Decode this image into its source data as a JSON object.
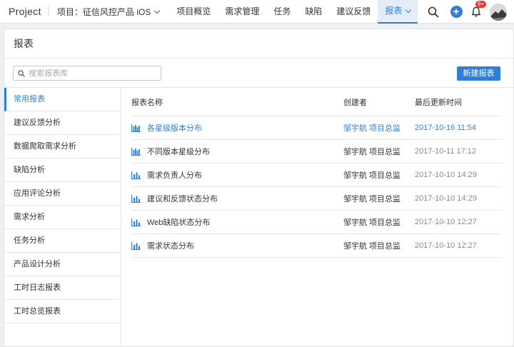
{
  "app": {
    "brand": "Project"
  },
  "project": {
    "label": "项目：征信风控产品 iOS"
  },
  "nav": {
    "items": [
      {
        "label": "项目概览"
      },
      {
        "label": "需求管理"
      },
      {
        "label": "任务"
      },
      {
        "label": "缺陷"
      },
      {
        "label": "建议反馈"
      }
    ],
    "active": {
      "label": "报表"
    }
  },
  "notifications": {
    "badge": "9+"
  },
  "page": {
    "title": "报表"
  },
  "search": {
    "placeholder": "搜索报表库",
    "value": ""
  },
  "toolbar": {
    "new_label": "新建报表"
  },
  "sidebar": {
    "items": [
      {
        "label": "常用报表"
      },
      {
        "label": "建议反馈分析"
      },
      {
        "label": "数据爬取需求分析"
      },
      {
        "label": "缺陷分析"
      },
      {
        "label": "应用评论分析"
      },
      {
        "label": "需求分析"
      },
      {
        "label": "任务分析"
      },
      {
        "label": "产品设计分析"
      },
      {
        "label": "工时日志报表"
      },
      {
        "label": "工时总览报表"
      }
    ]
  },
  "table": {
    "headers": {
      "name": "报表名称",
      "creator": "创建者",
      "updated": "最后更新时间"
    },
    "rows": [
      {
        "icon": "grouped-bar-chart-icon",
        "name": "各星级版本分布",
        "creator": "邹宇航 项目总监",
        "updated": "2017-10-16 11:54"
      },
      {
        "icon": "grouped-bar-chart-icon",
        "name": "不同版本星级分布",
        "creator": "邹宇航 项目总监",
        "updated": "2017-10-11 17:12"
      },
      {
        "icon": "bar-chart-icon",
        "name": "需求负责人分布",
        "creator": "邹宇航 项目总监",
        "updated": "2017-10-10 14:29"
      },
      {
        "icon": "bar-chart-icon",
        "name": "建议和反馈状态分布",
        "creator": "邹宇航 项目总监",
        "updated": "2017-10-10 14:29"
      },
      {
        "icon": "bar-chart-icon",
        "name": "Web缺陷状态分布",
        "creator": "邹宇航 项目总监",
        "updated": "2017-10-10 12:27"
      },
      {
        "icon": "bar-chart-icon",
        "name": "需求状态分布",
        "creator": "邹宇航 项目总监",
        "updated": "2017-10-10 12:27"
      }
    ]
  },
  "colors": {
    "accent": "#2f7fd6",
    "badge": "#e53935",
    "active_nav_bg": "#e4ecf7"
  }
}
